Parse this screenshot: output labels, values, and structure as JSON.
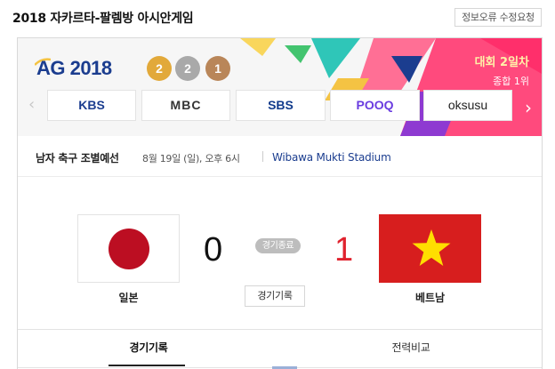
{
  "header": {
    "title": "2018 자카르타-팔렘방 아시안게임",
    "report_button": "정보오류 수정요청"
  },
  "banner": {
    "logo_text": "AG 2018",
    "medals": {
      "gold": "2",
      "silver": "2",
      "bronze": "1"
    },
    "day_label": "대회 2일차",
    "overall_rank": "종합 1위",
    "colors": {
      "pink": "#ff4a7d",
      "teal": "#2fc6b8",
      "navy": "#1b3d8f",
      "gold": "#e2a93a"
    }
  },
  "broadcasters": [
    "KBS",
    "MBC",
    "SBS",
    "POOQ",
    "oksusu"
  ],
  "match": {
    "event": "남자 축구 조별예선",
    "datetime": "8월 19일 (일), 오후 6시",
    "venue": "Wibawa Mukti Stadium",
    "status": "경기종료",
    "record_button": "경기기록",
    "home": {
      "name": "일본",
      "score": "0"
    },
    "away": {
      "name": "베트남",
      "score": "1"
    }
  },
  "tabs": [
    {
      "label": "경기기록",
      "active": true
    },
    {
      "label": "전력비교",
      "active": false
    }
  ]
}
